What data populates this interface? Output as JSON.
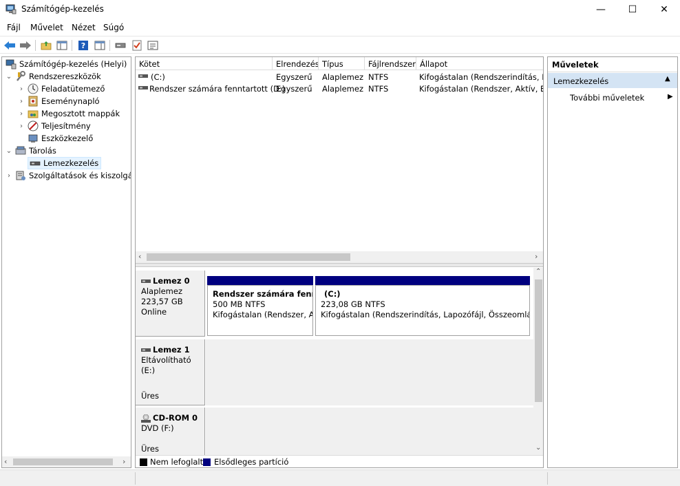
{
  "window": {
    "title": "Számítógép-kezelés",
    "minimize": "—",
    "maximize": "☐",
    "close": "✕"
  },
  "menu": [
    "Fájl",
    "Művelet",
    "Nézet",
    "Súgó"
  ],
  "tree": {
    "root": "Számítógép-kezelés (Helyi)",
    "system_tools": "Rendszereszközök",
    "task_scheduler": "Feladatütemező",
    "event_viewer": "Eseménynapló",
    "shared_folders": "Megosztott mappák",
    "performance": "Teljesítmény",
    "device_manager": "Eszközkezelő",
    "storage": "Tárolás",
    "disk_management": "Lemezkezelés",
    "services": "Szolgáltatások és kiszolgáló"
  },
  "volumes": {
    "columns": [
      "Kötet",
      "Elrendezés",
      "Típus",
      "Fájlrendszer",
      "Állapot"
    ],
    "rows": [
      [
        "(C:)",
        "Egyszerű",
        "Alaplemez",
        "NTFS",
        "Kifogástalan (Rendszerindítás, Lap"
      ],
      [
        "Rendszer számára fenntartott (D:)",
        "Egyszerű",
        "Alaplemez",
        "NTFS",
        "Kifogástalan (Rendszer, Aktív, Első"
      ]
    ]
  },
  "disks": [
    {
      "name": "Lemez 0",
      "type": "Alaplemez",
      "size": "223,57 GB",
      "status": "Online",
      "partitions": [
        {
          "name": "Rendszer számára fennta",
          "size": "500 MB NTFS",
          "status": "Kifogástalan (Rendszer, Akt"
        },
        {
          "name": "(C:)",
          "size": "223,08 GB NTFS",
          "status": "Kifogástalan (Rendszerindítás, Lapozófájl, Összeomlási m"
        }
      ]
    },
    {
      "name": "Lemez 1",
      "type": "Eltávolítható (E:)",
      "status": "Üres"
    },
    {
      "name": "CD-ROM 0",
      "type": "DVD (F:)",
      "status": "Üres"
    }
  ],
  "legend": {
    "unallocated": "Nem lefoglalt",
    "primary": "Elsődleges partíció"
  },
  "actions": {
    "header": "Műveletek",
    "section": "Lemezkezelés",
    "more": "További műveletek"
  },
  "colors": {
    "primary_partition": "#00007f",
    "selection": "#cce8ff"
  }
}
